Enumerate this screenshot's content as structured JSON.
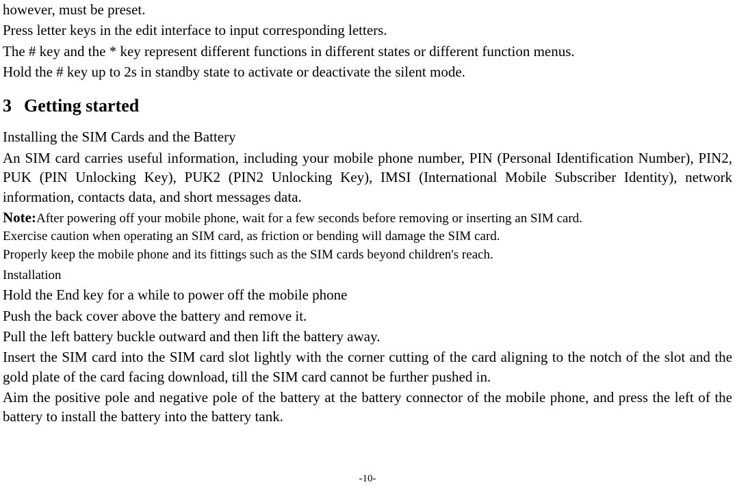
{
  "intro": {
    "line1": "however, must be preset.",
    "line2": "Press letter keys in the edit interface to input corresponding letters.",
    "line3": "The # key and the * key represent different functions in different states or different function menus.",
    "line4": "Hold the # key up to 2s in standby state to activate or deactivate the silent mode."
  },
  "heading": {
    "number": "3",
    "title": "Getting started"
  },
  "section": {
    "subtitle": "Installing the SIM Cards and the Battery",
    "sim_info": "An SIM card carries useful information, including your mobile phone number, PIN (Personal Identification Number), PIN2, PUK (PIN Unlocking Key), PUK2 (PIN2 Unlocking Key), IMSI (International Mobile Subscriber Identity), network information, contacts data, and short messages data.",
    "note_label": "Note:",
    "note_text": "After powering off your mobile phone, wait for a few seconds before removing or inserting an SIM card.",
    "caution1": "Exercise caution when operating an SIM card, as friction or bending will damage the SIM card.",
    "caution2": "Properly keep the mobile phone and its fittings such as the SIM cards beyond children's reach.",
    "install_label": "Installation",
    "step1": "Hold the End key for a while to power off the mobile phone",
    "step2": "Push the back cover above the battery and remove it.",
    "step3": "Pull the left battery buckle outward and then lift the battery away.",
    "step4": "Insert the SIM card into the SIM card slot lightly with the corner cutting of the card aligning to the notch of the slot and the gold plate of the card facing download, till the SIM card cannot be further pushed in.",
    "step5": "Aim the positive pole and negative pole of the battery at the battery connector of the mobile phone, and press the left of the battery to install the battery into the battery tank."
  },
  "page_number": "-10-"
}
